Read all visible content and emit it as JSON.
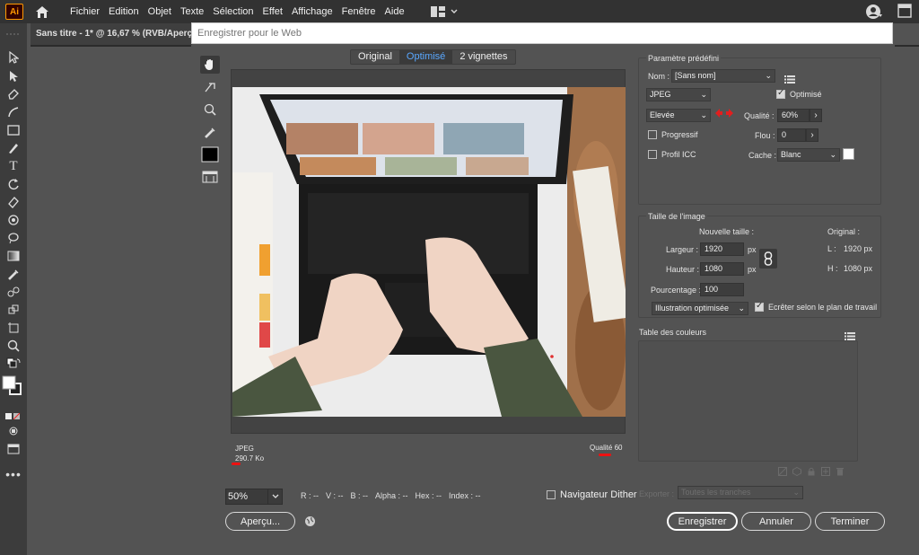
{
  "menubar": {
    "logo": "Ai",
    "items": [
      "Fichier",
      "Edition",
      "Objet",
      "Texte",
      "Sélection",
      "Effet",
      "Affichage",
      "Fenêtre",
      "Aide"
    ]
  },
  "document_tab": "Sans titre - 1* @ 16,67 % (RVB/Aperçu)",
  "url_input": {
    "placeholder": "Enregistrer pour le Web"
  },
  "view_tabs": [
    {
      "label": "Original",
      "active": false
    },
    {
      "label": "Optimisé",
      "active": true
    },
    {
      "label": "2 vignettes",
      "active": false
    }
  ],
  "preview": {
    "format": "JPEG",
    "size": "290.7 Ko",
    "quality_label": "Qualité 60"
  },
  "bottom": {
    "zoom": "50%",
    "r": "R : --",
    "v": "V : --",
    "b": "B : --",
    "alpha": "Alpha : --",
    "hex": "Hex : --",
    "index": "Index : --",
    "nav_dither": "Navigateur Dither",
    "preview_button": "Aperçu...",
    "save_button": "Enregistrer",
    "cancel_button": "Annuler",
    "done_button": "Terminer"
  },
  "preset": {
    "title": "Paramètre prédéfini",
    "name_label": "Nom :",
    "name_value": "[Sans nom]",
    "format": "JPEG",
    "optimise_label": "Optimisé",
    "optimise_checked": true,
    "quality_level": "Elevée",
    "quality_label": "Qualité :",
    "quality_value": "60%",
    "progressive_label": "Progressif",
    "progressive_checked": false,
    "blur_label": "Flou :",
    "blur_value": "0",
    "icc_label": "Profil ICC",
    "icc_checked": false,
    "matte_label": "Cache :",
    "matte_value": "Blanc"
  },
  "image_size": {
    "title": "Taille de l'image",
    "new_size_label": "Nouvelle taille :",
    "original_label": "Original :",
    "width_label": "Largeur :",
    "width_value": "1920",
    "height_label": "Hauteur :",
    "height_value": "1080",
    "unit": "px",
    "percent_label": "Pourcentage :",
    "percent_value": "100",
    "orig_w_label": "L :",
    "orig_w_value": "1920 px",
    "orig_h_label": "H :",
    "orig_h_value": "1080 px",
    "art_optimized": "Illustration optimisée",
    "clip_label": "Ecrêter selon le plan de travail",
    "clip_checked": true
  },
  "color_table": {
    "title": "Table des couleurs"
  },
  "export": {
    "label": "Exporter :",
    "value": "Toutes les tranches"
  }
}
